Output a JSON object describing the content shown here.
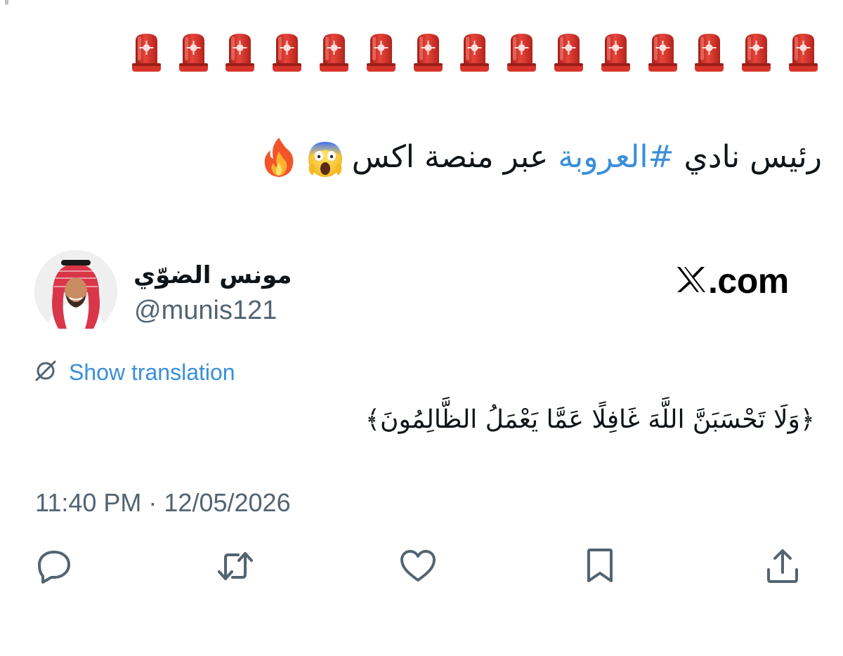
{
  "post": {
    "siren_count": 15,
    "headline_pre": "رئيس نادي ",
    "headline_hashtag": "#العروبة",
    "headline_post": " عبر منصة اكس",
    "headline_emojis": [
      "face-screaming-in-fear-emoji",
      "fire-emoji"
    ]
  },
  "quoted_card": {
    "author_name": "مونس الضوّي",
    "author_handle": "@munis121",
    "site_label": ".com",
    "site_logo": "x-logo-icon",
    "translation_label": "Show translation",
    "text": "﴿وَلَا تَحْسَبَنَّ اللَّهَ غَافِلًا عَمَّا يَعْمَلُ الظَّالِمُونَ﴾",
    "timestamp": "11:40 PM · 12/05/2026"
  },
  "actions": [
    "reply-icon",
    "retweet-icon",
    "like-icon",
    "bookmark-icon",
    "share-icon"
  ],
  "colors": {
    "link": "#3a8fd9",
    "secondary_text": "#536471",
    "primary_text": "#0f1419",
    "siren_red": "#e0362b"
  }
}
